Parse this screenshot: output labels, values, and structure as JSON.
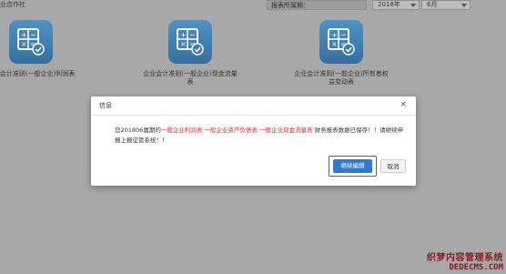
{
  "app": {
    "brand": "业合作社"
  },
  "filters": {
    "period_label": "报表所属期：",
    "year": "2018年",
    "month": "6月"
  },
  "tiles": [
    {
      "label": "企业会计准则(一般企业)利润表"
    },
    {
      "label": "企业会计准则(一般企业)现金流量表"
    },
    {
      "label": "企业会计准则(一般企业)所有者权益变动表"
    }
  ],
  "modal": {
    "title": "信息",
    "close": "×",
    "msg_pre": "您201806属期的",
    "report1": "一般企业利润表",
    "report2": "一般企业资产负债表",
    "report3": "一般企业现金流量表",
    "msg_post": "财务报表数据已保存！！请继续申报上报征管系统！！",
    "continue_label": "继续编辑",
    "cancel_label": "取消"
  },
  "watermark": {
    "line1": "织梦内容管理系统",
    "line2": "DEDECMS.COM"
  },
  "colors": {
    "accent": "#2f7bd1",
    "highlight_red": "#e0262a",
    "icon_blue": "#4387bd"
  }
}
